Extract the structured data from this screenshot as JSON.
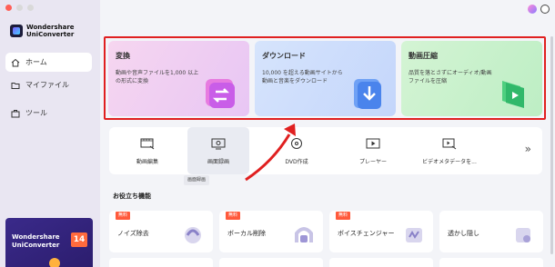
{
  "sidebar": {
    "brand": {
      "line1": "Wondershare",
      "line2": "UniConverter"
    },
    "items": [
      {
        "label": "ホーム",
        "icon": "home-icon",
        "active": true
      },
      {
        "label": "マイファイル",
        "icon": "folder-icon",
        "active": false
      },
      {
        "label": "ツール",
        "icon": "toolbox-icon",
        "active": false
      }
    ],
    "promo": {
      "line1": "Wondershare",
      "line2": "UniConverter",
      "badge": "14"
    }
  },
  "features": [
    {
      "title": "変換",
      "desc": "動画や音声ファイルを1,000 以上の形式に変換",
      "color": "#f0c8ee"
    },
    {
      "title": "ダウンロード",
      "desc": "10,000 を超える動画サイトから動画と音楽をダウンロード",
      "color": "#cfe0fb"
    },
    {
      "title": "動画圧縮",
      "desc": "品質を落とさずにオーディオ/動画ファイルを圧縮",
      "color": "#c8f0cc"
    }
  ],
  "tools": [
    {
      "label": "動画編集",
      "icon": "video-edit-icon"
    },
    {
      "label": "画面録画",
      "icon": "screen-record-icon"
    },
    {
      "label": "DVD作成",
      "icon": "dvd-icon"
    },
    {
      "label": "プレーヤー",
      "icon": "player-icon"
    },
    {
      "label": "ビデオメタデータを...",
      "icon": "metadata-icon"
    }
  ],
  "tooltip": "画面録画",
  "section_title": "お役立ち機能",
  "cards": [
    {
      "label": "ノイズ除去",
      "badge": "無料"
    },
    {
      "label": "ボーカル削除",
      "badge": "無料"
    },
    {
      "label": "ボイスチェンジャー",
      "badge": "無料"
    },
    {
      "label": "透かし隠し",
      "badge": ""
    }
  ],
  "colors": {
    "accent": "#e02020",
    "badge": "#ff5a3c"
  }
}
